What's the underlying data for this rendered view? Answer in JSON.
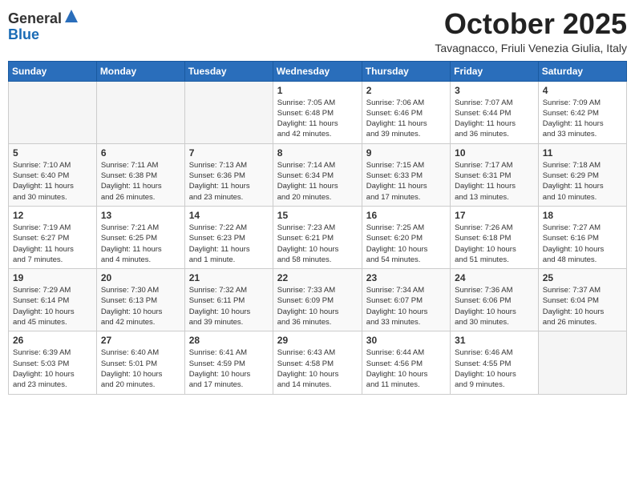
{
  "header": {
    "logo": {
      "line1": "General",
      "line2": "Blue"
    },
    "title": "October 2025",
    "location": "Tavagnacco, Friuli Venezia Giulia, Italy"
  },
  "weekdays": [
    "Sunday",
    "Monday",
    "Tuesday",
    "Wednesday",
    "Thursday",
    "Friday",
    "Saturday"
  ],
  "weeks": [
    [
      {
        "day": "",
        "info": ""
      },
      {
        "day": "",
        "info": ""
      },
      {
        "day": "",
        "info": ""
      },
      {
        "day": "1",
        "info": "Sunrise: 7:05 AM\nSunset: 6:48 PM\nDaylight: 11 hours\nand 42 minutes."
      },
      {
        "day": "2",
        "info": "Sunrise: 7:06 AM\nSunset: 6:46 PM\nDaylight: 11 hours\nand 39 minutes."
      },
      {
        "day": "3",
        "info": "Sunrise: 7:07 AM\nSunset: 6:44 PM\nDaylight: 11 hours\nand 36 minutes."
      },
      {
        "day": "4",
        "info": "Sunrise: 7:09 AM\nSunset: 6:42 PM\nDaylight: 11 hours\nand 33 minutes."
      }
    ],
    [
      {
        "day": "5",
        "info": "Sunrise: 7:10 AM\nSunset: 6:40 PM\nDaylight: 11 hours\nand 30 minutes."
      },
      {
        "day": "6",
        "info": "Sunrise: 7:11 AM\nSunset: 6:38 PM\nDaylight: 11 hours\nand 26 minutes."
      },
      {
        "day": "7",
        "info": "Sunrise: 7:13 AM\nSunset: 6:36 PM\nDaylight: 11 hours\nand 23 minutes."
      },
      {
        "day": "8",
        "info": "Sunrise: 7:14 AM\nSunset: 6:34 PM\nDaylight: 11 hours\nand 20 minutes."
      },
      {
        "day": "9",
        "info": "Sunrise: 7:15 AM\nSunset: 6:33 PM\nDaylight: 11 hours\nand 17 minutes."
      },
      {
        "day": "10",
        "info": "Sunrise: 7:17 AM\nSunset: 6:31 PM\nDaylight: 11 hours\nand 13 minutes."
      },
      {
        "day": "11",
        "info": "Sunrise: 7:18 AM\nSunset: 6:29 PM\nDaylight: 11 hours\nand 10 minutes."
      }
    ],
    [
      {
        "day": "12",
        "info": "Sunrise: 7:19 AM\nSunset: 6:27 PM\nDaylight: 11 hours\nand 7 minutes."
      },
      {
        "day": "13",
        "info": "Sunrise: 7:21 AM\nSunset: 6:25 PM\nDaylight: 11 hours\nand 4 minutes."
      },
      {
        "day": "14",
        "info": "Sunrise: 7:22 AM\nSunset: 6:23 PM\nDaylight: 11 hours\nand 1 minute."
      },
      {
        "day": "15",
        "info": "Sunrise: 7:23 AM\nSunset: 6:21 PM\nDaylight: 10 hours\nand 58 minutes."
      },
      {
        "day": "16",
        "info": "Sunrise: 7:25 AM\nSunset: 6:20 PM\nDaylight: 10 hours\nand 54 minutes."
      },
      {
        "day": "17",
        "info": "Sunrise: 7:26 AM\nSunset: 6:18 PM\nDaylight: 10 hours\nand 51 minutes."
      },
      {
        "day": "18",
        "info": "Sunrise: 7:27 AM\nSunset: 6:16 PM\nDaylight: 10 hours\nand 48 minutes."
      }
    ],
    [
      {
        "day": "19",
        "info": "Sunrise: 7:29 AM\nSunset: 6:14 PM\nDaylight: 10 hours\nand 45 minutes."
      },
      {
        "day": "20",
        "info": "Sunrise: 7:30 AM\nSunset: 6:13 PM\nDaylight: 10 hours\nand 42 minutes."
      },
      {
        "day": "21",
        "info": "Sunrise: 7:32 AM\nSunset: 6:11 PM\nDaylight: 10 hours\nand 39 minutes."
      },
      {
        "day": "22",
        "info": "Sunrise: 7:33 AM\nSunset: 6:09 PM\nDaylight: 10 hours\nand 36 minutes."
      },
      {
        "day": "23",
        "info": "Sunrise: 7:34 AM\nSunset: 6:07 PM\nDaylight: 10 hours\nand 33 minutes."
      },
      {
        "day": "24",
        "info": "Sunrise: 7:36 AM\nSunset: 6:06 PM\nDaylight: 10 hours\nand 30 minutes."
      },
      {
        "day": "25",
        "info": "Sunrise: 7:37 AM\nSunset: 6:04 PM\nDaylight: 10 hours\nand 26 minutes."
      }
    ],
    [
      {
        "day": "26",
        "info": "Sunrise: 6:39 AM\nSunset: 5:03 PM\nDaylight: 10 hours\nand 23 minutes."
      },
      {
        "day": "27",
        "info": "Sunrise: 6:40 AM\nSunset: 5:01 PM\nDaylight: 10 hours\nand 20 minutes."
      },
      {
        "day": "28",
        "info": "Sunrise: 6:41 AM\nSunset: 4:59 PM\nDaylight: 10 hours\nand 17 minutes."
      },
      {
        "day": "29",
        "info": "Sunrise: 6:43 AM\nSunset: 4:58 PM\nDaylight: 10 hours\nand 14 minutes."
      },
      {
        "day": "30",
        "info": "Sunrise: 6:44 AM\nSunset: 4:56 PM\nDaylight: 10 hours\nand 11 minutes."
      },
      {
        "day": "31",
        "info": "Sunrise: 6:46 AM\nSunset: 4:55 PM\nDaylight: 10 hours\nand 9 minutes."
      },
      {
        "day": "",
        "info": ""
      }
    ]
  ]
}
